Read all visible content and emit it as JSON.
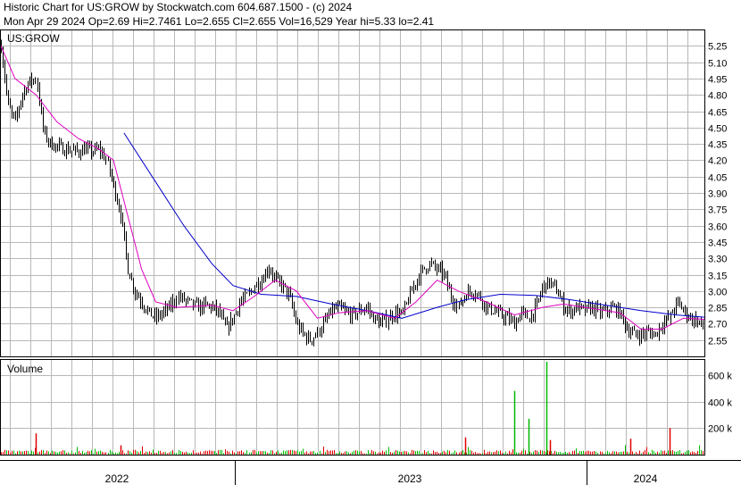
{
  "header": {
    "line1": "Historic Chart for US:GROW by Stockwatch.com 604.687.1500 - (c) 2024",
    "line2": "Mon Apr 29 2024   Op=2.69   Hi=2.7461   Lo=2.655   Cl=2.655   Vol=16,529   Year hi=5.33   lo=2.41"
  },
  "chart_data": {
    "type": "bar",
    "symbol_label": "US:GROW",
    "volume_label": "Volume",
    "price_axis": {
      "ticks": [
        2.55,
        2.7,
        2.85,
        3.0,
        3.15,
        3.3,
        3.45,
        3.6,
        3.75,
        3.9,
        4.05,
        4.2,
        4.35,
        4.5,
        4.65,
        4.8,
        4.95,
        5.1,
        5.25
      ],
      "tick_labels": [
        "2.55",
        "2.70",
        "2.85",
        "3.00",
        "3.15",
        "3.30",
        "3.45",
        "3.60",
        "3.75",
        "3.90",
        "4.05",
        "4.20",
        "4.35",
        "4.50",
        "4.65",
        "4.80",
        "4.95",
        "5.10",
        "5.25"
      ],
      "range": [
        2.4,
        5.4
      ]
    },
    "volume_axis": {
      "ticks": [
        200000,
        400000,
        600000
      ],
      "tick_labels": [
        "200 k",
        "400 k",
        "600 k"
      ],
      "range": [
        0,
        720000
      ]
    },
    "x_labels": [
      "2022",
      "2023",
      "2024"
    ],
    "grid": true,
    "price_series": [
      {
        "t": 0.0,
        "v": 5.25
      },
      {
        "t": 0.01,
        "v": 4.7
      },
      {
        "t": 0.02,
        "v": 4.55
      },
      {
        "t": 0.03,
        "v": 4.8
      },
      {
        "t": 0.04,
        "v": 4.92
      },
      {
        "t": 0.05,
        "v": 4.95
      },
      {
        "t": 0.06,
        "v": 4.45
      },
      {
        "t": 0.07,
        "v": 4.35
      },
      {
        "t": 0.09,
        "v": 4.3
      },
      {
        "t": 0.11,
        "v": 4.28
      },
      {
        "t": 0.12,
        "v": 4.3
      },
      {
        "t": 0.13,
        "v": 4.28
      },
      {
        "t": 0.14,
        "v": 4.3
      },
      {
        "t": 0.15,
        "v": 4.2
      },
      {
        "t": 0.16,
        "v": 3.95
      },
      {
        "t": 0.17,
        "v": 3.7
      },
      {
        "t": 0.18,
        "v": 3.2
      },
      {
        "t": 0.19,
        "v": 3.0
      },
      {
        "t": 0.2,
        "v": 2.9
      },
      {
        "t": 0.21,
        "v": 2.8
      },
      {
        "t": 0.22,
        "v": 2.75
      },
      {
        "t": 0.23,
        "v": 2.8
      },
      {
        "t": 0.24,
        "v": 2.85
      },
      {
        "t": 0.25,
        "v": 2.95
      },
      {
        "t": 0.26,
        "v": 2.92
      },
      {
        "t": 0.27,
        "v": 2.88
      },
      {
        "t": 0.28,
        "v": 2.85
      },
      {
        "t": 0.29,
        "v": 2.87
      },
      {
        "t": 0.3,
        "v": 2.85
      },
      {
        "t": 0.31,
        "v": 2.8
      },
      {
        "t": 0.32,
        "v": 2.65
      },
      {
        "t": 0.33,
        "v": 2.75
      },
      {
        "t": 0.34,
        "v": 2.9
      },
      {
        "t": 0.35,
        "v": 2.95
      },
      {
        "t": 0.36,
        "v": 3.05
      },
      {
        "t": 0.37,
        "v": 3.1
      },
      {
        "t": 0.38,
        "v": 3.22
      },
      {
        "t": 0.39,
        "v": 3.1
      },
      {
        "t": 0.4,
        "v": 3.05
      },
      {
        "t": 0.41,
        "v": 2.95
      },
      {
        "t": 0.42,
        "v": 2.7
      },
      {
        "t": 0.43,
        "v": 2.6
      },
      {
        "t": 0.44,
        "v": 2.55
      },
      {
        "t": 0.45,
        "v": 2.62
      },
      {
        "t": 0.46,
        "v": 2.72
      },
      {
        "t": 0.47,
        "v": 2.82
      },
      {
        "t": 0.48,
        "v": 2.85
      },
      {
        "t": 0.49,
        "v": 2.8
      },
      {
        "t": 0.5,
        "v": 2.78
      },
      {
        "t": 0.51,
        "v": 2.82
      },
      {
        "t": 0.52,
        "v": 2.85
      },
      {
        "t": 0.53,
        "v": 2.75
      },
      {
        "t": 0.54,
        "v": 2.7
      },
      {
        "t": 0.55,
        "v": 2.75
      },
      {
        "t": 0.56,
        "v": 2.8
      },
      {
        "t": 0.57,
        "v": 2.78
      },
      {
        "t": 0.58,
        "v": 2.95
      },
      {
        "t": 0.59,
        "v": 3.1
      },
      {
        "t": 0.6,
        "v": 3.2
      },
      {
        "t": 0.61,
        "v": 3.25
      },
      {
        "t": 0.62,
        "v": 3.2
      },
      {
        "t": 0.63,
        "v": 3.15
      },
      {
        "t": 0.64,
        "v": 2.95
      },
      {
        "t": 0.65,
        "v": 2.85
      },
      {
        "t": 0.66,
        "v": 2.98
      },
      {
        "t": 0.67,
        "v": 3.0
      },
      {
        "t": 0.68,
        "v": 2.95
      },
      {
        "t": 0.69,
        "v": 2.85
      },
      {
        "t": 0.7,
        "v": 2.82
      },
      {
        "t": 0.71,
        "v": 2.78
      },
      {
        "t": 0.72,
        "v": 2.75
      },
      {
        "t": 0.73,
        "v": 2.7
      },
      {
        "t": 0.74,
        "v": 2.8
      },
      {
        "t": 0.75,
        "v": 2.75
      },
      {
        "t": 0.76,
        "v": 2.85
      },
      {
        "t": 0.77,
        "v": 3.05
      },
      {
        "t": 0.78,
        "v": 3.08
      },
      {
        "t": 0.79,
        "v": 3.0
      },
      {
        "t": 0.8,
        "v": 2.85
      },
      {
        "t": 0.81,
        "v": 2.82
      },
      {
        "t": 0.82,
        "v": 2.85
      },
      {
        "t": 0.83,
        "v": 2.82
      },
      {
        "t": 0.84,
        "v": 2.85
      },
      {
        "t": 0.85,
        "v": 2.8
      },
      {
        "t": 0.86,
        "v": 2.82
      },
      {
        "t": 0.87,
        "v": 2.85
      },
      {
        "t": 0.88,
        "v": 2.8
      },
      {
        "t": 0.89,
        "v": 2.65
      },
      {
        "t": 0.9,
        "v": 2.6
      },
      {
        "t": 0.91,
        "v": 2.6
      },
      {
        "t": 0.92,
        "v": 2.62
      },
      {
        "t": 0.93,
        "v": 2.6
      },
      {
        "t": 0.94,
        "v": 2.7
      },
      {
        "t": 0.95,
        "v": 2.75
      },
      {
        "t": 0.96,
        "v": 2.9
      },
      {
        "t": 0.97,
        "v": 2.82
      },
      {
        "t": 0.98,
        "v": 2.75
      },
      {
        "t": 0.99,
        "v": 2.72
      },
      {
        "t": 1.0,
        "v": 2.66
      }
    ],
    "ma_short": [
      {
        "t": 0.0,
        "v": 5.25
      },
      {
        "t": 0.02,
        "v": 4.95
      },
      {
        "t": 0.05,
        "v": 4.8
      },
      {
        "t": 0.08,
        "v": 4.55
      },
      {
        "t": 0.11,
        "v": 4.4
      },
      {
        "t": 0.14,
        "v": 4.3
      },
      {
        "t": 0.16,
        "v": 4.2
      },
      {
        "t": 0.18,
        "v": 3.7
      },
      {
        "t": 0.2,
        "v": 3.2
      },
      {
        "t": 0.22,
        "v": 2.9
      },
      {
        "t": 0.25,
        "v": 2.85
      },
      {
        "t": 0.3,
        "v": 2.87
      },
      {
        "t": 0.33,
        "v": 2.82
      },
      {
        "t": 0.36,
        "v": 2.95
      },
      {
        "t": 0.39,
        "v": 3.1
      },
      {
        "t": 0.42,
        "v": 3.0
      },
      {
        "t": 0.45,
        "v": 2.75
      },
      {
        "t": 0.48,
        "v": 2.8
      },
      {
        "t": 0.52,
        "v": 2.82
      },
      {
        "t": 0.56,
        "v": 2.75
      },
      {
        "t": 0.59,
        "v": 2.9
      },
      {
        "t": 0.62,
        "v": 3.1
      },
      {
        "t": 0.65,
        "v": 3.0
      },
      {
        "t": 0.69,
        "v": 2.9
      },
      {
        "t": 0.73,
        "v": 2.78
      },
      {
        "t": 0.77,
        "v": 2.85
      },
      {
        "t": 0.8,
        "v": 2.88
      },
      {
        "t": 0.85,
        "v": 2.83
      },
      {
        "t": 0.88,
        "v": 2.8
      },
      {
        "t": 0.91,
        "v": 2.65
      },
      {
        "t": 0.94,
        "v": 2.65
      },
      {
        "t": 0.97,
        "v": 2.75
      },
      {
        "t": 1.0,
        "v": 2.74
      }
    ],
    "ma_long": [
      {
        "t": 0.175,
        "v": 4.45
      },
      {
        "t": 0.22,
        "v": 4.0
      },
      {
        "t": 0.26,
        "v": 3.6
      },
      {
        "t": 0.3,
        "v": 3.25
      },
      {
        "t": 0.33,
        "v": 3.05
      },
      {
        "t": 0.37,
        "v": 2.97
      },
      {
        "t": 0.42,
        "v": 2.95
      },
      {
        "t": 0.47,
        "v": 2.88
      },
      {
        "t": 0.52,
        "v": 2.82
      },
      {
        "t": 0.57,
        "v": 2.75
      },
      {
        "t": 0.62,
        "v": 2.85
      },
      {
        "t": 0.66,
        "v": 2.92
      },
      {
        "t": 0.71,
        "v": 2.97
      },
      {
        "t": 0.76,
        "v": 2.96
      },
      {
        "t": 0.81,
        "v": 2.92
      },
      {
        "t": 0.86,
        "v": 2.87
      },
      {
        "t": 0.91,
        "v": 2.82
      },
      {
        "t": 0.96,
        "v": 2.78
      },
      {
        "t": 1.0,
        "v": 2.76
      }
    ],
    "volume_spikes": [
      {
        "t": 0.05,
        "v": 160000
      },
      {
        "t": 0.17,
        "v": 70000
      },
      {
        "t": 0.66,
        "v": 130000
      },
      {
        "t": 0.73,
        "v": 480000
      },
      {
        "t": 0.75,
        "v": 270000
      },
      {
        "t": 0.775,
        "v": 700000
      },
      {
        "t": 0.78,
        "v": 110000
      },
      {
        "t": 0.895,
        "v": 120000
      },
      {
        "t": 0.95,
        "v": 200000
      }
    ],
    "colors": {
      "price": "#000000",
      "ma_short": "#e000c0",
      "ma_long": "#0000cc",
      "vol_down": "#e00000",
      "vol_up": "#00bb00",
      "grid": "#b8b8b8"
    }
  }
}
